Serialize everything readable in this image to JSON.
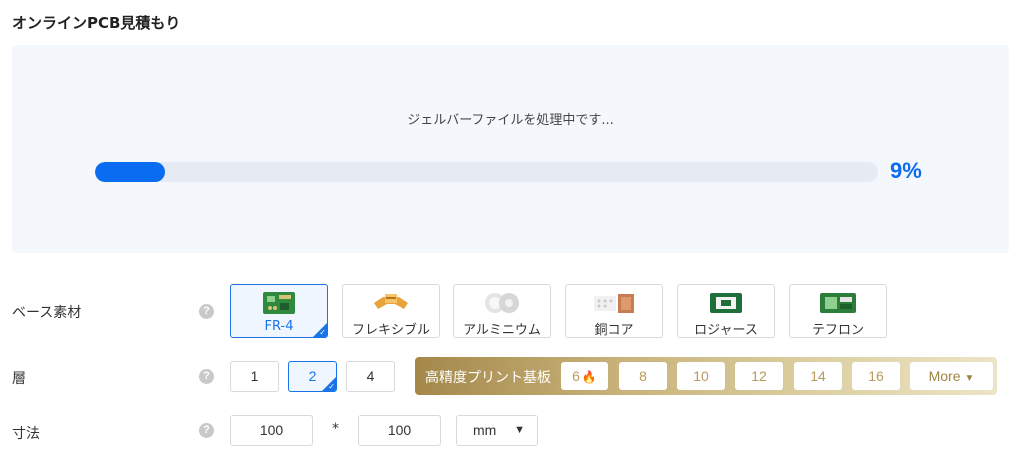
{
  "page_title": "オンラインPCB見積もり",
  "upload": {
    "status_text": "ジェルバーファイルを処理中です...",
    "progress": 9,
    "progress_label": "9%"
  },
  "base_material": {
    "label": "ベース素材",
    "help": "?",
    "options": [
      {
        "label": "FR-4",
        "selected": true
      },
      {
        "label": "フレキシブル"
      },
      {
        "label": "アルミニウム"
      },
      {
        "label": "銅コア"
      },
      {
        "label": "ロジャース"
      },
      {
        "label": "テフロン"
      }
    ]
  },
  "layers": {
    "label": "層",
    "help": "?",
    "options": [
      {
        "label": "1"
      },
      {
        "label": "2",
        "selected": true
      },
      {
        "label": "4"
      }
    ],
    "high_precision": {
      "title": "高精度プリント基板",
      "options": [
        "6",
        "8",
        "10",
        "12",
        "14",
        "16"
      ],
      "more_label": "More"
    }
  },
  "dimensions": {
    "label": "寸法",
    "help": "?",
    "width": "100",
    "separator": "*",
    "height": "100",
    "unit": "mm"
  },
  "colors": {
    "accent": "#1a73e8",
    "progress": "#0a6cf0",
    "gold": "#b89a5a"
  },
  "icons": {
    "help": "question-circle-icon",
    "check": "check-icon",
    "hot": "fire-icon",
    "caret": "caret-down-icon"
  }
}
